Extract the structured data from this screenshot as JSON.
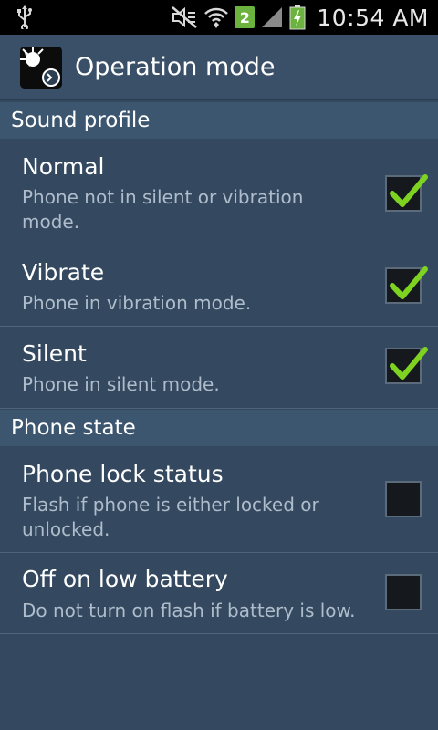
{
  "status_bar": {
    "time": "10:54 AM",
    "sim_slot": "2",
    "icons": [
      "usb-icon",
      "mute-icon",
      "wifi-icon",
      "sim-icon",
      "signal-icon",
      "battery-charging-icon"
    ]
  },
  "header": {
    "title": "Operation mode",
    "icon": "flashlight-app-icon"
  },
  "sections": [
    {
      "label": "Sound profile",
      "items": [
        {
          "title": "Normal",
          "subtitle": "Phone not in silent or vibration mode.",
          "checked": true
        },
        {
          "title": "Vibrate",
          "subtitle": "Phone in vibration mode.",
          "checked": true
        },
        {
          "title": "Silent",
          "subtitle": "Phone in silent mode.",
          "checked": true
        }
      ]
    },
    {
      "label": "Phone state",
      "items": [
        {
          "title": "Phone lock status",
          "subtitle": "Flash if phone is either locked or unlocked.",
          "checked": false
        },
        {
          "title": "Off on low battery",
          "subtitle": "Do not turn on flash if battery is low.",
          "checked": false
        }
      ]
    }
  ],
  "colors": {
    "background": "#34495f",
    "header": "#3a5069",
    "section_header": "#3d566f",
    "check": "#7ed321",
    "subtitle": "#aebccb"
  }
}
